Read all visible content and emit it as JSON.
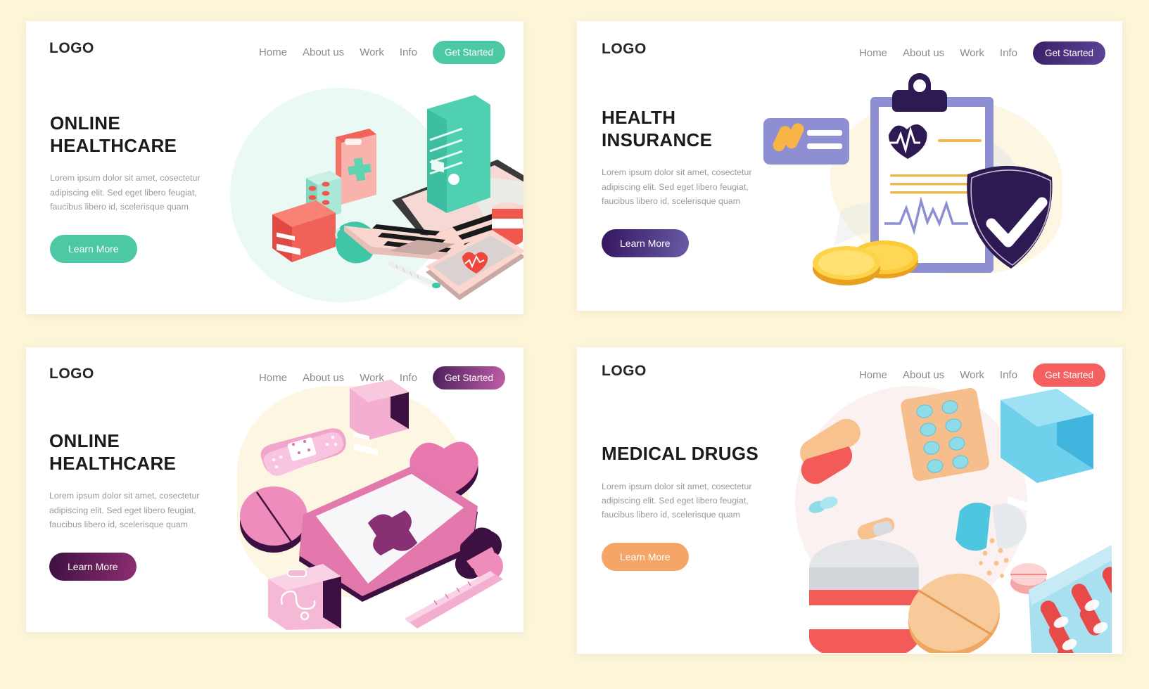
{
  "page": {
    "background": "#FDF5D8",
    "panel_count": 4
  },
  "panels": [
    {
      "id": "online-healthcare-teal",
      "logo": "LOGO",
      "nav": [
        "Home",
        "About us",
        "Work",
        "Info"
      ],
      "cta_label": "Get Started",
      "cta_color": "#4CC9A4",
      "title": "ONLINE\nHEALTHCARE",
      "paragraph": "Lorem ipsum dolor sit amet, cosectetur\nadipiscing elit. Sed eget libero feugiat,\nfaucibus libero id, scelerisque quam",
      "learn_label": "Learn More",
      "learn_color": "#4CC9A4",
      "accent": "#4CC9A4",
      "illustration": "isometric-laptop-medical-desk"
    },
    {
      "id": "health-insurance",
      "logo": "LOGO",
      "nav": [
        "Home",
        "About us",
        "Work",
        "Info"
      ],
      "cta_label": "Get Started",
      "cta_color": "#3C2466",
      "title": "HEALTH\nINSURANCE",
      "paragraph": "Lorem ipsum dolor sit amet, cosectetur\nadipiscing elit. Sed eget libero feugiat,\nfaucibus libero id, scelerisque quam",
      "learn_label": "Learn More",
      "learn_color": "#3C2466",
      "accent": "#2E1A52",
      "illustration": "clipboard-shield-coins-card"
    },
    {
      "id": "online-healthcare-pink",
      "logo": "LOGO",
      "nav": [
        "Home",
        "About us",
        "Work",
        "Info"
      ],
      "cta_label": "Get Started",
      "cta_color": "#6E2A63",
      "title": "ONLINE\nHEALTHCARE",
      "paragraph": "Lorem ipsum dolor sit amet, cosectetur\nadipiscing elit. Sed eget libero feugiat,\nfaucibus libero id, scelerisque quam",
      "learn_label": "Learn More",
      "learn_color": "#5B2057",
      "accent": "#E07CB4",
      "illustration": "isometric-phone-pink-medical"
    },
    {
      "id": "medical-drugs",
      "logo": "LOGO",
      "nav": [
        "Home",
        "About us",
        "Work",
        "Info"
      ],
      "cta_label": "Get Started",
      "cta_color": "#F4605F",
      "title": "MEDICAL DRUGS",
      "paragraph": "Lorem ipsum dolor sit amet, cosectetur\nadipiscing elit. Sed eget libero feugiat,\nfaucibus libero id, scelerisque quam",
      "learn_label": "Learn More",
      "learn_color": "#F5A567",
      "accent": "#F4605F",
      "illustration": "pills-capsules-bottle-blisters"
    }
  ]
}
